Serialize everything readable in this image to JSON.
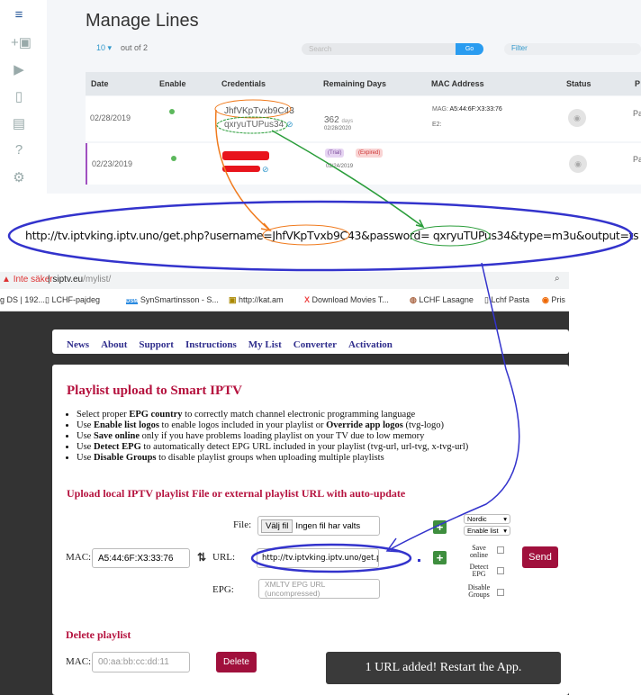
{
  "panel": {
    "title": "Manage Lines",
    "page_size": "10",
    "out_of": "out of 2",
    "search_placeholder": "Search",
    "go": "Go",
    "filter_placeholder": "Filter",
    "columns": [
      "Date",
      "Enable",
      "Credentials",
      "Remaining Days",
      "MAC Address",
      "Status",
      "P"
    ],
    "rows": [
      {
        "date": "02/28/2019",
        "username": "JhfVKpTvxb9C43",
        "password": "qxryuTUPus34",
        "days": "362",
        "days_unit": "days",
        "expiry": "02/28/2020",
        "mac_label": "MAG:",
        "mac": "A5:44:6F:X3:33:76",
        "e2_label": "E2:",
        "p": "Pa"
      },
      {
        "date": "02/23/2019",
        "trial": "(Trial)",
        "expired": "(Expired)",
        "expiry": "02/24/2019",
        "p": "Pa"
      }
    ]
  },
  "url_callout": "http://tv.iptvking.iptv.uno/get.php?username=JhfVKpTvxb9C43&password= qxryuTUPus34&type=m3u&output=ts",
  "browser": {
    "warning": "Inte säker",
    "domain": "siptv.eu",
    "path": "/mylist/",
    "bookmarks": [
      "g DS | 192....",
      "LCHF-pajdeg",
      "SynSmartinsson - S...",
      "http://kat.am",
      "Download Movies T...",
      "LCHF Lasagne",
      "Lchf Pasta",
      "Pris"
    ]
  },
  "site": {
    "nav": [
      "News",
      "About",
      "Support",
      "Instructions",
      "My List",
      "Converter",
      "Activation"
    ],
    "title": "Playlist upload to Smart IPTV",
    "bullets": [
      [
        "Select proper ",
        "EPG country",
        " to correctly match channel electronic programming language"
      ],
      [
        "Use ",
        "Enable list logos",
        " to enable logos included in your playlist or ",
        "Override app logos",
        " (tvg-logo)"
      ],
      [
        "Use ",
        "Save online",
        " only if you have problems loading playlist on your TV due to low memory"
      ],
      [
        "Use ",
        "Detect EPG",
        " to automatically detect EPG URL included in your playlist (tvg-url, url-tvg, x-tvg-url)"
      ],
      [
        "Use ",
        "Disable Groups",
        " to disable playlist groups when uploading multiple playlists"
      ]
    ],
    "upload_heading": "Upload local IPTV playlist File or external playlist URL with auto-update",
    "file_label": "File:",
    "choose_file": "Välj fil",
    "no_file": "Ingen fil har valts",
    "mac_label": "MAC:",
    "mac_value": "A5:44:6F:X3:33:76",
    "url_label": "URL:",
    "url_value": "http://tv.iptvking.iptv.uno/get.p",
    "epg_label": "EPG:",
    "epg_placeholder": "XMLTV EPG URL (uncompressed)",
    "country": "Nordic",
    "logos": "Enable list",
    "save_online": "Save online",
    "detect_epg": "Detect EPG",
    "disable_groups": "Disable Groups",
    "send": "Send",
    "delete_heading": "Delete playlist",
    "delete_mac_placeholder": "00:aa:bb:cc:dd:11",
    "delete": "Delete",
    "toast": "1 URL added! Restart the App."
  },
  "colors": {
    "accent": "#b5123e",
    "nav": "#2f2d8c",
    "annotation_blue": "#3333cc",
    "annotation_orange": "#f07b1e",
    "annotation_green": "#2a9d3a"
  }
}
